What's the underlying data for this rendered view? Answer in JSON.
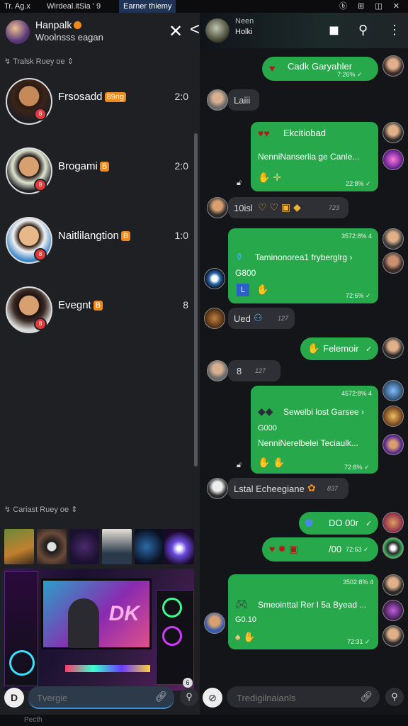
{
  "browser": {
    "tabs": [
      "Tr. Ag.x",
      "Wirdeal.itSia ' 9",
      "Earner thiemy"
    ],
    "status_icons": "ⓑ ⊞ ◫ ✕"
  },
  "left_panel": {
    "header": {
      "name": "Hanpalk",
      "subtitle": "Woolnsss eagan",
      "close": "✕",
      "back": "<"
    },
    "section_contacts": "Tralsk Ruey oe",
    "contacts": [
      {
        "name": "Frsosadd",
        "tag": "89rig",
        "count": "2:0",
        "skin": "#c68a5a",
        "shirt": "#1e1e24"
      },
      {
        "name": "Brogami",
        "tag": "B",
        "count": "2:0",
        "skin": "#d8a070",
        "shirt": "#1e1e24"
      },
      {
        "name": "Naitlilangtion",
        "tag": "B",
        "count": "1:0",
        "skin": "#e6b88a",
        "shirt": "#3a86c8"
      },
      {
        "name": "Evegnt",
        "tag": "B",
        "count": "8",
        "skin": "#d8a070",
        "shirt": "#d8d8d8"
      }
    ],
    "section_media": "Cariast Ruey oe",
    "gaming_badge": "DK",
    "input_placeholder": "Tvergie",
    "input_plus": "D",
    "mic": "⚲"
  },
  "right_panel": {
    "header": {
      "title": "Neen",
      "subtitle": "Holki"
    },
    "icons": [
      "stop-icon",
      "search-icon",
      "more-icon"
    ],
    "messages": [
      {
        "dir": "out",
        "text": "Cadk Garyahler",
        "time": "7:26% ✓",
        "emoji": "♥"
      },
      {
        "dir": "in",
        "text": "Laiii"
      },
      {
        "dir": "out",
        "title": "Ekcitiobad",
        "text": "NenniNanserlia ge Canle...",
        "time": "22:8% ✓",
        "emoji": "♥♥"
      },
      {
        "dir": "in",
        "text": "10isl",
        "time": "723"
      },
      {
        "dir": "out",
        "meta": "3572:8% 4",
        "title": "Taminonorea1 fryberglrg ›",
        "extra": "G800",
        "time": "72:6% ✓"
      },
      {
        "dir": "in",
        "text": "Ued",
        "time": "127"
      },
      {
        "dir": "out",
        "text": "Felemoir",
        "time": "✓"
      },
      {
        "dir": "in",
        "text": "8",
        "time": "127"
      },
      {
        "dir": "out",
        "meta": "4572:8% 4",
        "title": "Sewelbi lost Garseе ›",
        "extra": "G000",
        "text": "NenniNerelbelei Teciaulk...",
        "time": "72:8% ✓"
      },
      {
        "dir": "in",
        "text": "Lstal Echeegiane",
        "time": "837"
      },
      {
        "dir": "out",
        "text": "DO 00r",
        "time": "✓"
      },
      {
        "dir": "out",
        "text": "/00",
        "time": "72:63 ✓"
      },
      {
        "dir": "out",
        "meta": "3502:8% 4",
        "title": "Smeointtal Rer I 5a Byead ...",
        "extra": "G0.10",
        "time": "72:31 ✓"
      }
    ],
    "input_placeholder": "Tredigilnaianls"
  },
  "footer": {
    "label": "Pecth"
  }
}
